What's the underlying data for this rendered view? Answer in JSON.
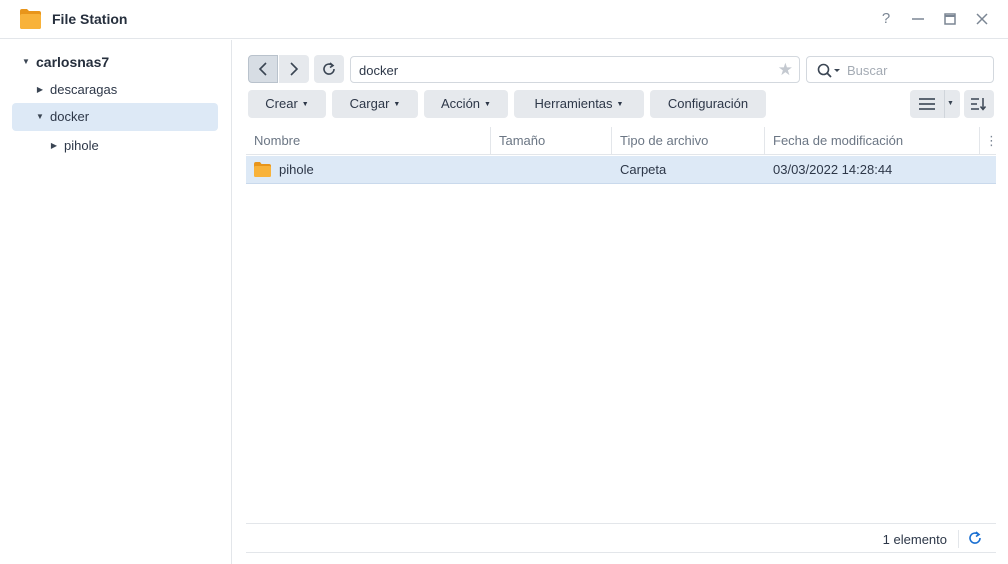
{
  "app": {
    "title": "File Station",
    "accent": "#1a6fd1",
    "folder_color": "#f5a623"
  },
  "window_controls": {
    "help": "?",
    "minimize": "—",
    "maximize": "□",
    "close": "✕"
  },
  "sidebar": {
    "root": "carlosnas7",
    "items": [
      {
        "label": "descaragas"
      },
      {
        "label": "docker"
      },
      {
        "label": "pihole"
      }
    ]
  },
  "nav": {
    "back": "‹",
    "forward": "›"
  },
  "path": {
    "value": "docker"
  },
  "search": {
    "placeholder": "Buscar"
  },
  "toolbar": {
    "crear": "Crear",
    "cargar": "Cargar",
    "accion": "Acción",
    "herramientas": "Herramientas",
    "configuracion": "Configuración"
  },
  "table": {
    "columns": [
      "Nombre",
      "Tamaño",
      "Tipo de archivo",
      "Fecha de modificación"
    ],
    "rows": [
      {
        "name": "pihole",
        "size": "",
        "type": "Carpeta",
        "modified": "03/03/2022 14:28:44"
      }
    ]
  },
  "status": {
    "count": "1 elemento"
  }
}
